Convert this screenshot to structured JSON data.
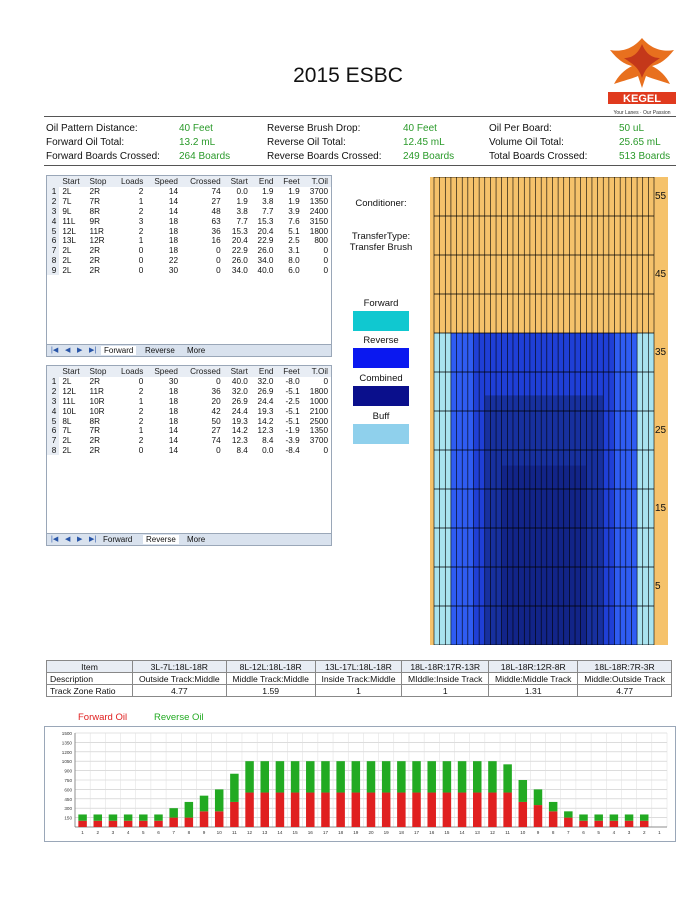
{
  "title": "2015 ESBC",
  "logo": {
    "brand": "KEGEL",
    "tagline": "Your Lanes · Our Passion"
  },
  "info": [
    {
      "label": "Oil Pattern Distance:",
      "value": "40 Feet"
    },
    {
      "label": "Reverse Brush Drop:",
      "value": "40 Feet"
    },
    {
      "label": "Oil Per Board:",
      "value": "50 uL"
    },
    {
      "label": "Forward Oil Total:",
      "value": "13.2 mL"
    },
    {
      "label": "Reverse Oil Total:",
      "value": "12.45 mL"
    },
    {
      "label": "Volume Oil Total:",
      "value": "25.65 mL"
    },
    {
      "label": "Forward Boards Crossed:",
      "value": "264 Boards"
    },
    {
      "label": "Reverse Boards Crossed:",
      "value": "249 Boards"
    },
    {
      "label": "Total Boards Crossed:",
      "value": "513 Boards"
    }
  ],
  "loads_columns": [
    "",
    "Start",
    "Stop",
    "Loads",
    "Speed",
    "Crossed",
    "Start",
    "End",
    "Feet",
    "T.Oil"
  ],
  "forward_table": {
    "rows": [
      [
        "1",
        "2L",
        "2R",
        "2",
        "14",
        "74",
        "0.0",
        "1.9",
        "1.9",
        "3700"
      ],
      [
        "2",
        "7L",
        "7R",
        "1",
        "14",
        "27",
        "1.9",
        "3.8",
        "1.9",
        "1350"
      ],
      [
        "3",
        "9L",
        "8R",
        "2",
        "14",
        "48",
        "3.8",
        "7.7",
        "3.9",
        "2400"
      ],
      [
        "4",
        "11L",
        "9R",
        "3",
        "18",
        "63",
        "7.7",
        "15.3",
        "7.6",
        "3150"
      ],
      [
        "5",
        "12L",
        "11R",
        "2",
        "18",
        "36",
        "15.3",
        "20.4",
        "5.1",
        "1800"
      ],
      [
        "6",
        "13L",
        "12R",
        "1",
        "18",
        "16",
        "20.4",
        "22.9",
        "2.5",
        "800"
      ],
      [
        "7",
        "2L",
        "2R",
        "0",
        "18",
        "0",
        "22.9",
        "26.0",
        "3.1",
        "0"
      ],
      [
        "8",
        "2L",
        "2R",
        "0",
        "22",
        "0",
        "26.0",
        "34.0",
        "8.0",
        "0"
      ],
      [
        "9",
        "2L",
        "2R",
        "0",
        "30",
        "0",
        "34.0",
        "40.0",
        "6.0",
        "0"
      ]
    ],
    "tabs": [
      "Forward",
      "Reverse",
      "More"
    ],
    "active_tab": 0
  },
  "reverse_table": {
    "rows": [
      [
        "1",
        "2L",
        "2R",
        "0",
        "30",
        "0",
        "40.0",
        "32.0",
        "-8.0",
        "0"
      ],
      [
        "2",
        "12L",
        "11R",
        "2",
        "18",
        "36",
        "32.0",
        "26.9",
        "-5.1",
        "1800"
      ],
      [
        "3",
        "11L",
        "10R",
        "1",
        "18",
        "20",
        "26.9",
        "24.4",
        "-2.5",
        "1000"
      ],
      [
        "4",
        "10L",
        "10R",
        "2",
        "18",
        "42",
        "24.4",
        "19.3",
        "-5.1",
        "2100"
      ],
      [
        "5",
        "8L",
        "8R",
        "2",
        "18",
        "50",
        "19.3",
        "14.2",
        "-5.1",
        "2500"
      ],
      [
        "6",
        "7L",
        "7R",
        "1",
        "14",
        "27",
        "14.2",
        "12.3",
        "-1.9",
        "1350"
      ],
      [
        "7",
        "2L",
        "2R",
        "2",
        "14",
        "74",
        "12.3",
        "8.4",
        "-3.9",
        "3700"
      ],
      [
        "8",
        "2L",
        "2R",
        "0",
        "14",
        "0",
        "8.4",
        "0.0",
        "-8.4",
        "0"
      ]
    ],
    "tabs": [
      "Forward",
      "Reverse",
      "More"
    ],
    "active_tab": 1
  },
  "nav_glyphs": [
    "|◀",
    "◀",
    "▶",
    "▶|"
  ],
  "side": {
    "conditioner": "Conditioner:",
    "transfer_type": "TransferType:",
    "transfer_value": "Transfer Brush",
    "legend": [
      {
        "label": "Forward",
        "color": "#10c8d0"
      },
      {
        "label": "Reverse",
        "color": "#0a18f0"
      },
      {
        "label": "Combined",
        "color": "#0a0f8c"
      },
      {
        "label": "Buff",
        "color": "#8fd0ec"
      }
    ]
  },
  "profile": {
    "y_ticks": [
      "55",
      "45",
      "35",
      "25",
      "15",
      "5"
    ],
    "feet_max": 60,
    "boards": 39,
    "colors": {
      "dry": "#f5c26b",
      "buff": "#a9e3ef",
      "l1": "#2f5cf2",
      "l2": "#1f3fd6",
      "l3": "#17309e",
      "l4": "#122488"
    },
    "levels": [
      {
        "board_from": 1,
        "board_to": 39,
        "feet": 40,
        "tone": "buff"
      },
      {
        "board_from": 4,
        "board_to": 36,
        "feet": 40,
        "tone": "l1"
      },
      {
        "board_from": 8,
        "board_to": 32,
        "feet": 40,
        "tone": "l2"
      },
      {
        "board_from": 10,
        "board_to": 30,
        "feet": 32,
        "tone": "l3"
      },
      {
        "board_from": 13,
        "board_to": 27,
        "feet": 23,
        "tone": "l4"
      }
    ]
  },
  "zone_table": {
    "headers": [
      "Item",
      "3L-7L:18L-18R",
      "8L-12L:18L-18R",
      "13L-17L:18L-18R",
      "18L-18R:17R-13R",
      "18L-18R:12R-8R",
      "18L-18R:7R-3R"
    ],
    "rows": [
      [
        "Description",
        "Outside Track:Middle",
        "Middle Track:Middle",
        "Inside Track:Middle",
        "MIddle:Inside Track",
        "Middle:Middle Track",
        "Middle:Outside Track"
      ],
      [
        "Track Zone Ratio",
        "4.77",
        "1.59",
        "1",
        "1",
        "1.31",
        "4.77"
      ]
    ]
  },
  "bar_legend": [
    {
      "label": "Forward Oil",
      "color": "#e02020"
    },
    {
      "label": "Reverse Oil",
      "color": "#22aa22"
    }
  ],
  "chart_data": {
    "type": "bar",
    "stacked": true,
    "categories": [
      "1",
      "2",
      "3",
      "4",
      "5",
      "6",
      "7",
      "8",
      "9",
      "10",
      "11",
      "12",
      "13",
      "14",
      "15",
      "16",
      "17",
      "18",
      "19",
      "20",
      "19",
      "18",
      "17",
      "16",
      "15",
      "14",
      "13",
      "12",
      "11",
      "10",
      "9",
      "8",
      "7",
      "6",
      "5",
      "4",
      "3",
      "2",
      "1"
    ],
    "series": [
      {
        "name": "Forward Oil",
        "color": "#e02020",
        "values": [
          100,
          100,
          100,
          100,
          100,
          100,
          150,
          150,
          250,
          250,
          400,
          550,
          550,
          550,
          550,
          550,
          550,
          550,
          550,
          550,
          550,
          550,
          550,
          550,
          550,
          550,
          550,
          550,
          550,
          400,
          350,
          250,
          150,
          100,
          100,
          100,
          100,
          100,
          0
        ]
      },
      {
        "name": "Reverse Oil",
        "color": "#22aa22",
        "values": [
          100,
          100,
          100,
          100,
          100,
          100,
          150,
          250,
          250,
          350,
          450,
          500,
          500,
          500,
          500,
          500,
          500,
          500,
          500,
          500,
          500,
          500,
          500,
          500,
          500,
          500,
          500,
          500,
          450,
          350,
          250,
          150,
          100,
          100,
          100,
          100,
          100,
          100,
          0
        ]
      }
    ],
    "y_ticks": [
      150,
      300,
      450,
      600,
      750,
      900,
      1050,
      1200,
      1350,
      1500
    ],
    "ylim": [
      0,
      1500
    ],
    "grid": true
  }
}
